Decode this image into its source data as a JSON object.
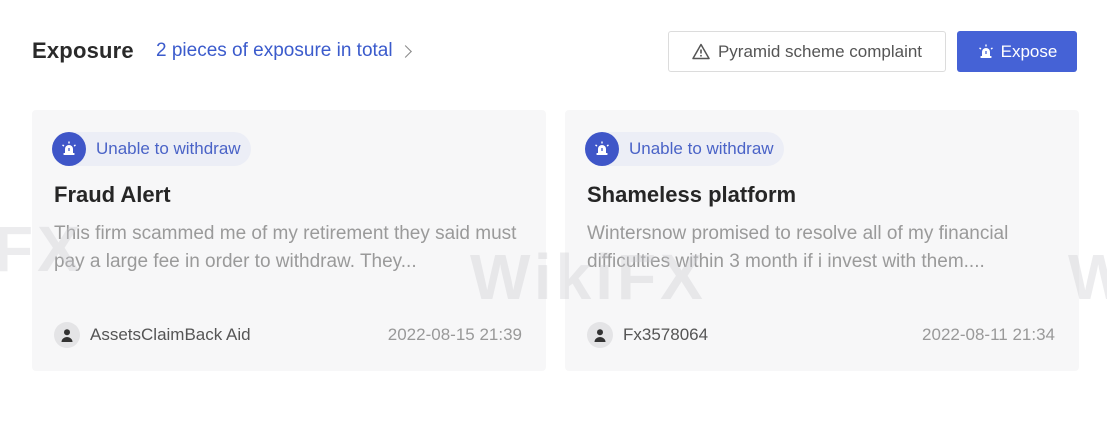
{
  "header": {
    "title": "Exposure",
    "count_text": "2 pieces of exposure in total",
    "complaint_button": "Pyramid scheme complaint",
    "expose_button": "Expose"
  },
  "cards": [
    {
      "tag": "Unable to withdraw",
      "title": "Fraud Alert",
      "body": "This firm scammed me of my retirement they said must pay a large fee in order to withdraw. They...",
      "author": "AssetsClaimBack Aid",
      "date": "2022-08-15 21:39"
    },
    {
      "tag": "Unable to withdraw",
      "title": "Shameless platform",
      "body": "Wintersnow promised to resolve all of my financial difficulties within 3 month if i invest with them....",
      "author": "Fx3578064",
      "date": "2022-08-11 21:34"
    }
  ],
  "watermarks": [
    "FX",
    "WikiFX",
    "W"
  ],
  "colors": {
    "accent": "#4562d6",
    "link": "#3b5bcc",
    "card_bg": "#f7f7f8"
  }
}
